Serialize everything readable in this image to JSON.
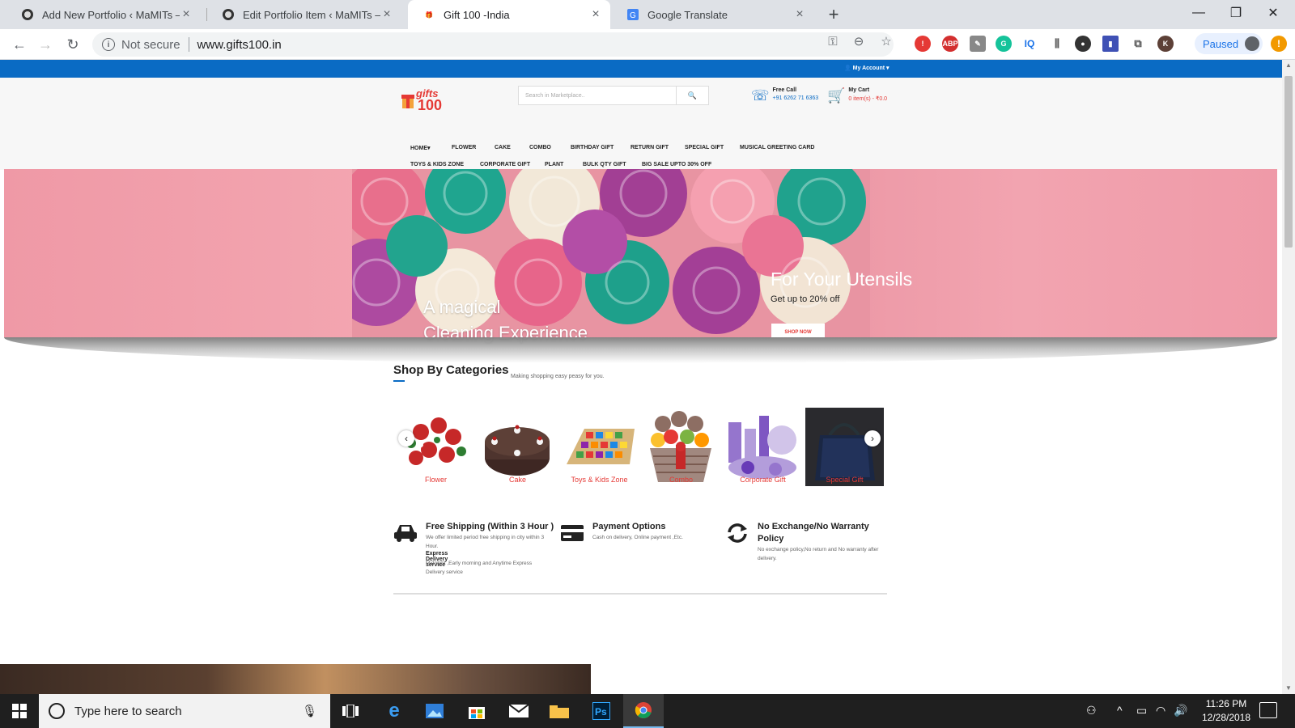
{
  "browser": {
    "tabs": [
      {
        "title": "Add New Portfolio ‹ MaMITs — W",
        "active": false
      },
      {
        "title": "Edit Portfolio Item ‹ MaMITs — W",
        "active": false
      },
      {
        "title": "Gift 100 -India",
        "active": true
      },
      {
        "title": "Google Translate",
        "active": false
      }
    ],
    "security": "Not secure",
    "url": "www.gifts100.in",
    "profile_status": "Paused",
    "extensions": [
      "ABP",
      "G",
      "IQ",
      "K"
    ]
  },
  "site": {
    "account": "My Account",
    "logo_text": "gifts",
    "logo_num": "100",
    "search_placeholder": "Search in Marketplace..",
    "free_call_label": "Free Call",
    "free_call_number": "+91 6262 71 6363",
    "cart_label": "My Cart",
    "cart_status": "0 item(s) - ₹0.0",
    "nav_row1": [
      "HOME",
      "FLOWER",
      "CAKE",
      "COMBO",
      "BIRTHDAY GIFT",
      "RETURN GIFT",
      "SPECIAL GIFT",
      "MUSICAL GREETING CARD"
    ],
    "nav_row2": [
      "TOYS & KIDS ZONE",
      "CORPORATE GIFT",
      "PLANT",
      "BULK QTY GIFT",
      "BIG SALE UPTO 30% OFF"
    ],
    "hero": {
      "left_line1": "A magical",
      "left_line2": "Cleaning Experience",
      "right_title": "For Your Utensils",
      "right_sub": "Get up to 20% off",
      "cta": "SHOP NOW"
    },
    "categories_title": "Shop By Categories",
    "categories_sub": "Making shopping easy peasy for you.",
    "categories": [
      "Flower",
      "Cake",
      "Toys & Kids Zone",
      "Combo",
      "Corporate Gift",
      "Special Gift"
    ],
    "features": [
      {
        "title": "Free Shipping (Within 3 Hour )",
        "desc": "We offer limited period free shipping in city within 3 Hour.",
        "sub_title": "Express Delivery service",
        "sub_desc": "Midnight ,Early morning and Anytime Express Delivery service"
      },
      {
        "title": "Payment Options",
        "desc": "Cash on delivery, Online payment ,Etc."
      },
      {
        "title": "No Exchange/No Warranty Policy",
        "desc": "No exchange policy,No return and No warranty after delivery."
      }
    ]
  },
  "taskbar": {
    "search_placeholder": "Type here to search",
    "time": "11:26 PM",
    "date": "12/28/2018"
  },
  "colors": {
    "brand_blue": "#0a6bc4",
    "accent_red": "#e53935",
    "hero_pink": "#ef99a6"
  }
}
